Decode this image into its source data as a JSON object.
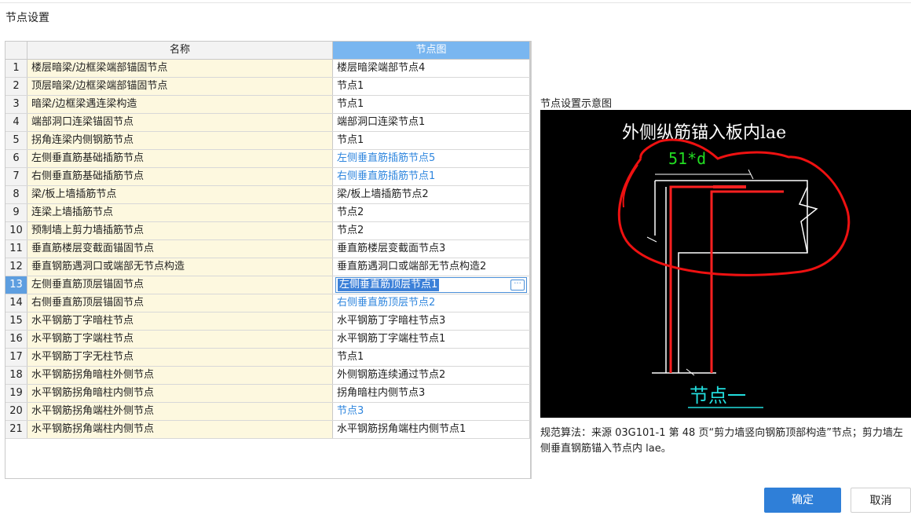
{
  "dialog": {
    "title": "节点设置",
    "confirm_label": "确定",
    "cancel_label": "取消"
  },
  "table": {
    "columns": {
      "name": "名称",
      "node": "节点图"
    },
    "selected_row": 13,
    "rows": [
      {
        "num": "1",
        "name": "楼层暗梁/边框梁端部锚固节点",
        "node": "楼层暗梁端部节点4",
        "modified": false
      },
      {
        "num": "2",
        "name": "顶层暗梁/边框梁端部锚固节点",
        "node": "节点1",
        "modified": false
      },
      {
        "num": "3",
        "name": "暗梁/边框梁遇连梁构造",
        "node": "节点1",
        "modified": false
      },
      {
        "num": "4",
        "name": "端部洞口连梁锚固节点",
        "node": "端部洞口连梁节点1",
        "modified": false
      },
      {
        "num": "5",
        "name": "拐角连梁内侧钢筋节点",
        "node": "节点1",
        "modified": false
      },
      {
        "num": "6",
        "name": "左侧垂直筋基础插筋节点",
        "node": "左侧垂直筋插筋节点5",
        "modified": true
      },
      {
        "num": "7",
        "name": "右侧垂直筋基础插筋节点",
        "node": "右侧垂直筋插筋节点1",
        "modified": true
      },
      {
        "num": "8",
        "name": "梁/板上墙插筋节点",
        "node": "梁/板上墙插筋节点2",
        "modified": false
      },
      {
        "num": "9",
        "name": "连梁上墙插筋节点",
        "node": "节点2",
        "modified": false
      },
      {
        "num": "10",
        "name": "预制墙上剪力墙插筋节点",
        "node": "节点2",
        "modified": false
      },
      {
        "num": "11",
        "name": "垂直筋楼层变截面锚固节点",
        "node": "垂直筋楼层变截面节点3",
        "modified": false
      },
      {
        "num": "12",
        "name": "垂直钢筋遇洞口或端部无节点构造",
        "node": "垂直筋遇洞口或端部无节点构造2",
        "modified": false
      },
      {
        "num": "13",
        "name": "左侧垂直筋顶层锚固节点",
        "node": "左侧垂直筋顶层节点1",
        "modified": true
      },
      {
        "num": "14",
        "name": "右侧垂直筋顶层锚固节点",
        "node": "右侧垂直筋顶层节点2",
        "modified": true
      },
      {
        "num": "15",
        "name": "水平钢筋丁字暗柱节点",
        "node": "水平钢筋丁字暗柱节点3",
        "modified": false
      },
      {
        "num": "16",
        "name": "水平钢筋丁字端柱节点",
        "node": "水平钢筋丁字端柱节点1",
        "modified": false
      },
      {
        "num": "17",
        "name": "水平钢筋丁字无柱节点",
        "node": "节点1",
        "modified": false
      },
      {
        "num": "18",
        "name": "水平钢筋拐角暗柱外侧节点",
        "node": "外侧钢筋连续通过节点2",
        "modified": false
      },
      {
        "num": "19",
        "name": "水平钢筋拐角暗柱内侧节点",
        "node": "拐角暗柱内侧节点3",
        "modified": false
      },
      {
        "num": "20",
        "name": "水平钢筋拐角端柱外侧节点",
        "node": "节点3",
        "modified": true
      },
      {
        "num": "21",
        "name": "水平钢筋拐角端柱内侧节点",
        "node": "水平钢筋拐角端柱内侧节点1",
        "modified": false
      }
    ],
    "edit_button_label": "···"
  },
  "preview": {
    "label": "节点设置示意图",
    "heading": "外侧纵筋锚入板内lae",
    "dimension": "51*d",
    "node_title": "节点一",
    "colors": {
      "background": "#000000",
      "rebar": "#ff2020",
      "outline": "#ffffff",
      "dimension": "#22dd22",
      "node_title": "#22dddd",
      "annotation": "#ee1111"
    }
  },
  "description": "规范算法：来源 03G101-1 第 48 页“剪力墙竖向钢筋顶部构造”节点；剪力墙左侧垂直钢筋锚入节点内 lae。"
}
